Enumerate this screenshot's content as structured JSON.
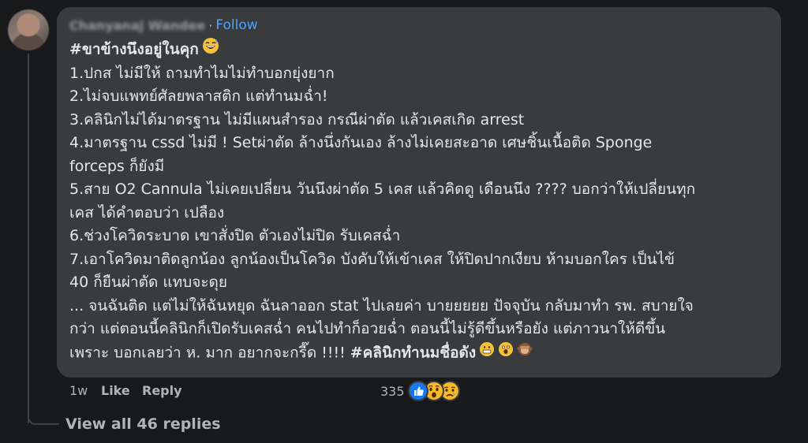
{
  "comment": {
    "author": "Chanyanaj Wandee",
    "separator": "·",
    "follow_label": "Follow",
    "lines": [
      "#ขาข้างนึงอยู่ในคุก",
      "1.ปกส ไม่มีให้ ถามทำไมไม่ทำบอกยุ่งยาก",
      "2.ไม่จบแพทย์ศัลยพลาสติก แต่ทำนมฉ่ำ!",
      "3.คลินิกไม่ได้มาตรฐาน ไม่มีแผนสำรอง กรณีผ่าตัด แล้วเคสเกิด arrest",
      "4.มาตรฐาน cssd ไม่มี ! Setผ่าตัด ล้างนึ่งกันเอง ล้างไม่เคยสะอาด เศษชิ้นเนื้อติด Sponge",
      "forceps ก็ยังมี",
      "5.สาย O2 Cannula ไม่เคยเปลี่ยน วันนึงผ่าตัด 5 เคส แล้วคิดดู เดือนนึง ???? บอกว่าให้เปลี่ยนทุก",
      "เคส ได้คำตอบว่า เปลือง",
      "6.ช่วงโควิดระบาด เขาสั่งปิด ตัวเองไม่ปิด รับเคสฉ่ำ",
      "7.เอาโควิดมาติดลูกน้อง ลูกน้องเป็นโควิด บังคับให้เข้าเคส ให้ปิดปากเงียบ ห้ามบอกใคร เป็นไข้",
      "40 ก็ยืนผ่าตัด แทบจะดุย",
      "... จนฉันติด แต่ไม่ให้ฉันหยุด ฉันลาออก stat ไปเลยค่า บายยยยย ปัจจุบัน กลับมาทำ รพ. สบายใจ",
      "กว่า แต่ตอนนี้คลินิกก็เปิดรับเคสฉ่ำ คนไปทำก็อวยฉ่ำ ตอนนี้ไม่รู้ดีขึ้นหรือยัง แต่ภาวนาให้ดีขึ้น",
      "เพราะ บอกเลยว่า ห. มาก อยากจะกรี๊ด !!!! "
    ],
    "last_hashtag": "#คลินิกทำนมชื่อดัง",
    "emoji_title": "grinning-sweat-emoji",
    "emoji_end": [
      "grimacing-face-emoji",
      "screaming-face-emoji",
      "see-no-evil-monkey-emoji"
    ]
  },
  "actions": {
    "time": "1w",
    "like_label": "Like",
    "reply_label": "Reply"
  },
  "reactions": {
    "count": "335",
    "types": [
      "like",
      "wow",
      "sad"
    ]
  },
  "view_replies_label": "View all 46 replies",
  "colors": {
    "background": "#18191a",
    "bubble": "#3a3b3c",
    "text": "#e4e6eb",
    "muted": "#b0b3b8",
    "link": "#4da3ff"
  }
}
